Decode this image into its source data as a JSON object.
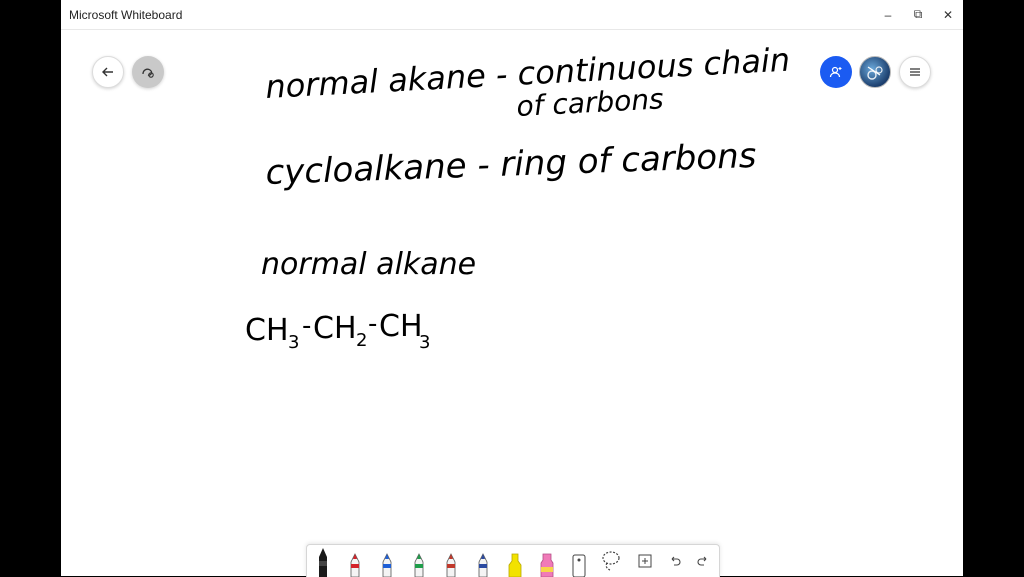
{
  "window": {
    "title": "Microsoft Whiteboard",
    "minimize_glyph": "–",
    "restore_glyph": "⧉",
    "close_glyph": "✕"
  },
  "board": {
    "lines": [
      "normal akane - continuous chain",
      "of carbons",
      "cycloalkane - ring of carbons",
      "normal alkane"
    ],
    "formula": {
      "c1": "CH",
      "s1": "3",
      "d1": "-",
      "c2": "CH",
      "s2": "2",
      "d2": "-",
      "c3": "CH",
      "s3": "3"
    }
  },
  "top_left_buttons": {
    "back_icon": "arrow-left-icon",
    "ink_icon": "ink-to-shape-icon"
  },
  "top_right_buttons": {
    "invite_icon": "person-add-icon",
    "avatar": "user-avatar",
    "menu_icon": "hamburger-menu-icon"
  },
  "toolbar": {
    "pens": [
      {
        "name": "black-pen",
        "color": "#111111"
      },
      {
        "name": "red-pen",
        "color": "#d3232a"
      },
      {
        "name": "blue-pen",
        "color": "#1f5fd6"
      },
      {
        "name": "green-pen",
        "color": "#1f9d4a"
      },
      {
        "name": "red-pen-2",
        "color": "#c0392b"
      },
      {
        "name": "dark-blue-pen",
        "color": "#2b4aa0"
      }
    ],
    "highlighters": [
      {
        "name": "yellow-highlighter",
        "color": "#f2e200"
      },
      {
        "name": "pink-highlighter",
        "color": "#f07ab8"
      }
    ]
  }
}
